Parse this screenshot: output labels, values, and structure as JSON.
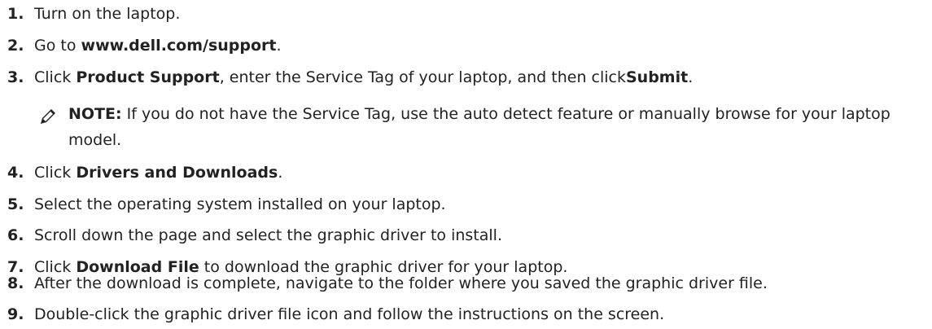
{
  "steps": [
    {
      "num": "1.",
      "parts": [
        "Turn on the laptop."
      ]
    },
    {
      "num": "2.",
      "parts": [
        "Go to ",
        "www.dell.com/support",
        "."
      ]
    },
    {
      "num": "3.",
      "parts": [
        "Click ",
        "Product Support",
        ", enter the Service Tag of your laptop, and then click",
        "Submit",
        "."
      ]
    },
    {
      "num": "4.",
      "parts": [
        "Click ",
        "Drivers and Downloads",
        "."
      ]
    },
    {
      "num": "5.",
      "parts": [
        "Select the operating system installed on your laptop."
      ]
    },
    {
      "num": "6.",
      "parts": [
        "Scroll down the page and select the graphic driver to install."
      ]
    },
    {
      "num": "7.",
      "parts": [
        "Click ",
        "Download File",
        " to download the graphic driver for your laptop."
      ]
    },
    {
      "num": "8.",
      "parts": [
        "After the download is complete, navigate to the folder where you saved the graphic driver file."
      ]
    },
    {
      "num": "9.",
      "parts": [
        "Double-click the graphic driver file icon and follow the instructions on the screen."
      ]
    }
  ],
  "note": {
    "label": "NOTE:",
    "text": " If you do not have the Service Tag, use the auto detect feature or manually browse for your laptop model.",
    "icon": "pencil-icon"
  }
}
